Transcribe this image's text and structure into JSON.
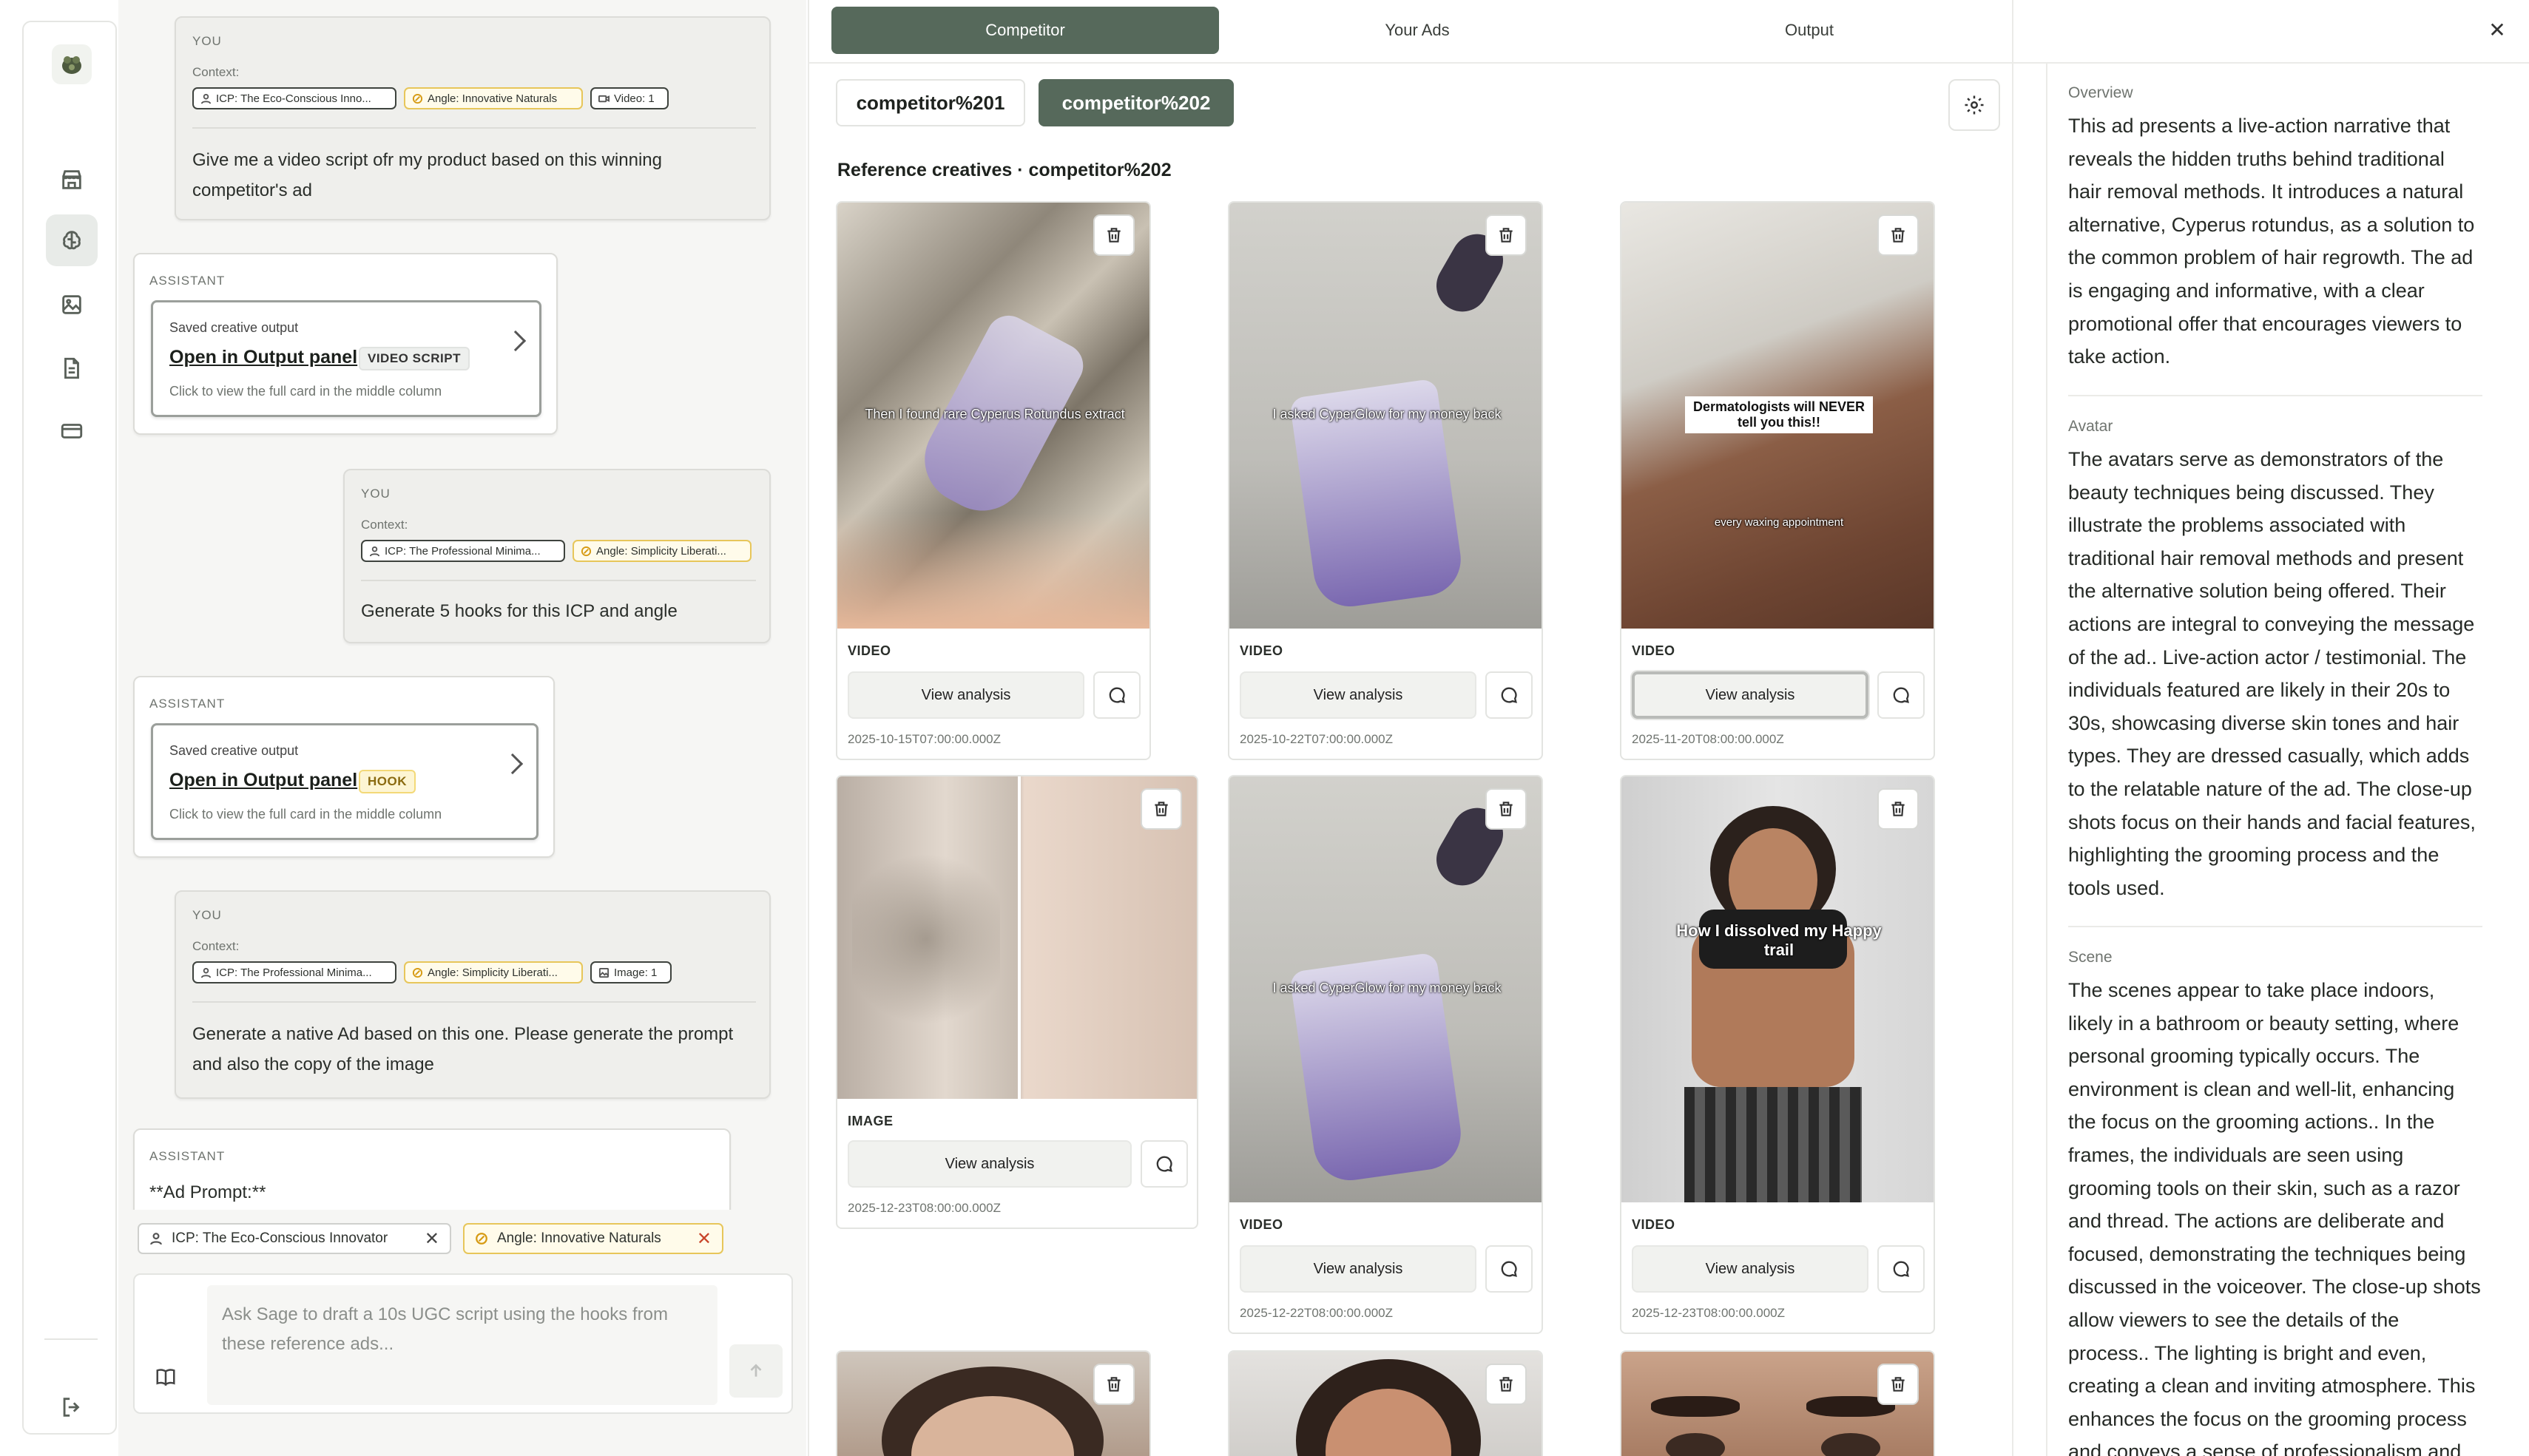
{
  "rail": {
    "logo": "sage-logo",
    "items": [
      {
        "name": "store-icon",
        "active": false
      },
      {
        "name": "brain-icon",
        "active": true
      },
      {
        "name": "image-icon",
        "active": false
      },
      {
        "name": "document-icon",
        "active": false
      },
      {
        "name": "card-icon",
        "active": false
      }
    ],
    "bottom": "logout-icon"
  },
  "chat": {
    "messages": [
      {
        "role": "YOU",
        "context_label": "Context:",
        "chips": [
          {
            "kind": "icp",
            "icon": "user-icon",
            "text": "ICP: The Eco-Conscious Inno..."
          },
          {
            "kind": "angle",
            "icon": "angle-icon",
            "text": "Angle: Innovative Naturals"
          },
          {
            "kind": "media",
            "icon": "video-icon",
            "text": "Video: 1"
          }
        ],
        "text": "Give me a video script ofr my product based on this winning competitor's ad"
      },
      {
        "role": "ASSISTANT",
        "saved": "Saved creative output",
        "open": "Open in Output panel",
        "tag": "VIDEO SCRIPT",
        "hint": "Click to view the full card in the middle column"
      },
      {
        "role": "YOU",
        "context_label": "Context:",
        "chips": [
          {
            "kind": "icp",
            "icon": "user-icon",
            "text": "ICP: The Professional Minima..."
          },
          {
            "kind": "angle",
            "icon": "angle-icon",
            "text": "Angle: Simplicity Liberati..."
          }
        ],
        "text": "Generate 5 hooks for this ICP and angle"
      },
      {
        "role": "ASSISTANT",
        "saved": "Saved creative output",
        "open": "Open in Output panel",
        "tag": "HOOK",
        "hint": "Click to view the full card in the middle column"
      },
      {
        "role": "YOU",
        "context_label": "Context:",
        "chips": [
          {
            "kind": "icp",
            "icon": "user-icon",
            "text": "ICP: The Professional Minima..."
          },
          {
            "kind": "angle",
            "icon": "angle-icon",
            "text": "Angle: Simplicity Liberati..."
          },
          {
            "kind": "media",
            "icon": "image-icon",
            "text": "Image: 1"
          }
        ],
        "text": "Generate a native Ad based on this one. Please generate the prompt and also the copy of the image"
      },
      {
        "role": "ASSISTANT",
        "text": "**Ad Prompt:**"
      }
    ],
    "active_chips": [
      {
        "kind": "icp",
        "icon": "user-icon",
        "text": "ICP: The Eco-Conscious Innovator"
      },
      {
        "kind": "angle",
        "icon": "angle-icon",
        "text": "Angle: Innovative Naturals"
      }
    ],
    "input_placeholder": "Ask Sage to draft a 10s UGC script using the hooks from these reference ads..."
  },
  "tabs": [
    "Competitor",
    "Your Ads",
    "Output"
  ],
  "active_tab": 0,
  "subtabs": [
    "competitor%201",
    "competitor%202"
  ],
  "active_subtab": 1,
  "section_title": "Reference creatives · competitor%202",
  "creatives": [
    {
      "type": "VIDEO",
      "view": "View analysis",
      "date": "2025-10-15T07:00:00.000Z",
      "overlay": "Then I found rare Cyperus Rotundus extract",
      "overlay2": ""
    },
    {
      "type": "VIDEO",
      "view": "View analysis",
      "date": "2025-10-22T07:00:00.000Z",
      "overlay": "I asked CyperGlow for my money back",
      "overlay2": ""
    },
    {
      "type": "VIDEO",
      "view": "View analysis",
      "date": "2025-11-20T08:00:00.000Z",
      "overlay": "Dermatologists will NEVER tell you this!!",
      "overlay2": "every waxing appointment"
    },
    {
      "type": "IMAGE",
      "view": "View analysis",
      "date": "2025-12-23T08:00:00.000Z",
      "overlay": "",
      "overlay2": ""
    },
    {
      "type": "VIDEO",
      "view": "View analysis",
      "date": "2025-12-22T08:00:00.000Z",
      "overlay": "I asked CyperGlow for my money back",
      "overlay2": ""
    },
    {
      "type": "VIDEO",
      "view": "View analysis",
      "date": "2025-12-23T08:00:00.000Z",
      "overlay": "How I dissolved my Happy trail",
      "overlay2": ""
    },
    {
      "type": "",
      "view": "",
      "date": "",
      "overlay": "",
      "overlay2": ""
    },
    {
      "type": "",
      "view": "",
      "date": "",
      "overlay": "",
      "overlay2": ""
    },
    {
      "type": "",
      "view": "",
      "date": "",
      "overlay": "",
      "overlay2": ""
    }
  ],
  "analysis": {
    "sections": [
      {
        "label": "Overview",
        "text": "This ad presents a live-action narrative that reveals the hidden truths behind traditional hair removal methods. It introduces a natural alternative, Cyperus rotundus, as a solution to the common problem of hair regrowth. The ad is engaging and informative, with a clear promotional offer that encourages viewers to take action."
      },
      {
        "label": "Avatar",
        "text": "The avatars serve as demonstrators of the beauty techniques being discussed. They illustrate the problems associated with traditional hair removal methods and present the alternative solution being offered. Their actions are integral to conveying the message of the ad.. Live-action actor / testimonial. The individuals featured are likely in their 20s to 30s, showcasing diverse skin tones and hair types. They are dressed casually, which adds to the relatable nature of the ad. The close-up shots focus on their hands and facial features, highlighting the grooming process and the tools used."
      },
      {
        "label": "Scene",
        "text": "The scenes appear to take place indoors, likely in a bathroom or beauty setting, where personal grooming typically occurs. The environment is clean and well-lit, enhancing the focus on the grooming actions.. In the frames, the individuals are seen using grooming tools on their skin, such as a razor and thread. The actions are deliberate and focused, demonstrating the techniques being discussed in the voiceover. The close-up shots allow viewers to see the details of the process.. The lighting is bright and even, creating a clean and inviting atmosphere. This enhances the focus on the grooming process and conveys a sense of professionalism and"
      }
    ]
  },
  "colors": {
    "accent": "#56695b",
    "angle_chip": "#e7c65a",
    "hook_tag": "#fdf5d3"
  }
}
